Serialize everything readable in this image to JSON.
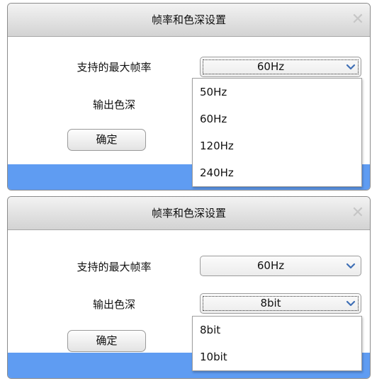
{
  "dialogs": [
    {
      "title": "帧率和色深设置",
      "close_glyph": "✕",
      "frame_rate_label": "支持的最大帧率",
      "color_depth_label": "输出色深",
      "frame_rate_value": "60Hz",
      "ok_label": "确定",
      "dropdown_options": [
        "50Hz",
        "60Hz",
        "120Hz",
        "240Hz"
      ]
    },
    {
      "title": "帧率和色深设置",
      "close_glyph": "✕",
      "frame_rate_label": "支持的最大帧率",
      "color_depth_label": "输出色深",
      "frame_rate_value": "60Hz",
      "color_depth_value": "8bit",
      "ok_label": "确定",
      "dropdown_options": [
        "8bit",
        "10bit"
      ]
    }
  ],
  "colors": {
    "footer_blue": "#5f9cf2",
    "chevron_blue": "#3f6fb5"
  }
}
